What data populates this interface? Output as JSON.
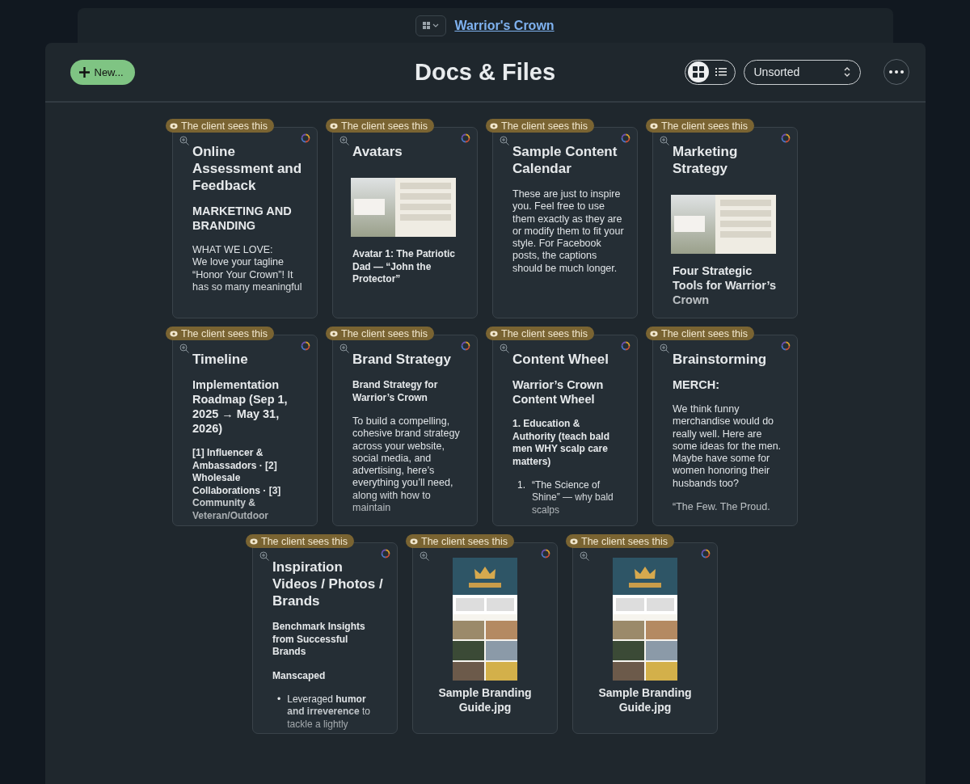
{
  "top_tab": {
    "link": "Warrior's Crown"
  },
  "header": {
    "new_button": "New...",
    "title": "Docs & Files",
    "views": [
      {
        "kind": "grid",
        "selected": true
      },
      {
        "kind": "list",
        "selected": false
      }
    ],
    "sort": "Unsorted"
  },
  "cards": [
    {
      "kind": "doc",
      "badge": "The client sees this",
      "title": "Online Assessment and Feedback",
      "blocks": [
        {
          "kind": "heading",
          "text": "MARKETING AND BRANDING"
        },
        {
          "kind": "paragraph",
          "text": "WHAT WE LOVE:\nWe love your tagline “Honor Your Crown”! It has so many meaningful"
        }
      ]
    },
    {
      "kind": "doc",
      "badge": "The client sees this",
      "title": "Avatars",
      "blocks": [
        {
          "kind": "image"
        },
        {
          "kind": "strong",
          "text": "Avatar 1: The Patriotic Dad — “John the Protector”"
        }
      ]
    },
    {
      "kind": "doc",
      "badge": "The client sees this",
      "title": "Sample Content Calendar",
      "blocks": [
        {
          "kind": "paragraph",
          "text": "These are just to inspire you. Feel free to use them exactly as they are or modify them to fit your style. For Facebook posts, the captions should be much longer."
        }
      ]
    },
    {
      "kind": "doc",
      "badge": "The client sees this",
      "title": "Marketing Strategy",
      "blocks": [
        {
          "kind": "image"
        },
        {
          "kind": "heading",
          "text": "Four Strategic Tools for Warrior’s Crown"
        }
      ]
    },
    {
      "kind": "doc",
      "badge": "The client sees this",
      "title": "Timeline",
      "blocks": [
        {
          "kind": "heading",
          "text": "Implementation Roadmap (Sep 1, 2025 → May 31, 2026)"
        },
        {
          "kind": "strong",
          "text": "[1] Influencer & Ambassadors · [2] Wholesale Collaborations · [3] Community & Veteran/Outdoor"
        }
      ]
    },
    {
      "kind": "doc",
      "badge": "The client sees this",
      "title": "Brand Strategy",
      "blocks": [
        {
          "kind": "strong",
          "text": "Brand Strategy for Warrior’s Crown"
        },
        {
          "kind": "paragraph",
          "text": "To build a compelling, cohesive brand strategy across your website, social media, and advertising, here’s everything you’ll need, along with how to maintain"
        }
      ]
    },
    {
      "kind": "doc",
      "badge": "The client sees this",
      "title": "Content Wheel",
      "blocks": [
        {
          "kind": "heading",
          "text": "Warrior’s Crown Content Wheel"
        },
        {
          "kind": "strong",
          "text": "1. Education & Authority (teach bald men WHY scalp care matters)"
        },
        {
          "kind": "numbered",
          "marker": "1.",
          "text": "“The Science of Shine” — why bald scalps"
        }
      ]
    },
    {
      "kind": "doc",
      "badge": "The client sees this",
      "title": "Brainstorming",
      "blocks": [
        {
          "kind": "heading",
          "text": "MERCH:"
        },
        {
          "kind": "paragraph",
          "text": "We think funny merchandise would do really well. Here are some ideas for the men. Maybe have some for women honoring their husbands too?"
        },
        {
          "kind": "paragraph",
          "text": "“The Few. The Proud."
        }
      ]
    },
    {
      "kind": "doc",
      "badge": "The client sees this",
      "title": "Inspiration Videos / Photos / Brands",
      "blocks": [
        {
          "kind": "strong",
          "text": "Benchmark Insights from Successful Brands"
        },
        {
          "kind": "strong",
          "text": "Manscaped"
        },
        {
          "kind": "bullet",
          "marker": "•",
          "text": "Leveraged **humor and irreverence** to tackle a lightly"
        }
      ]
    },
    {
      "kind": "image",
      "badge": "The client sees this",
      "title": "Sample Branding Guide.jpg"
    },
    {
      "kind": "image",
      "badge": "The client sees this",
      "title": "Sample Branding Guide.jpg"
    }
  ]
}
